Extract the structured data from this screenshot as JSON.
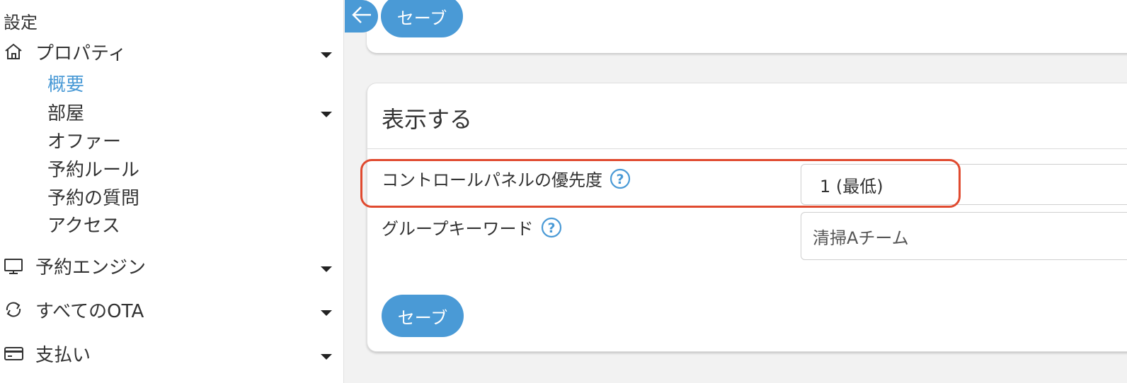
{
  "sidebar": {
    "title": "設定",
    "items": [
      {
        "label": "プロパティ",
        "icon": "home-icon"
      },
      {
        "label": "予約エンジン",
        "icon": "monitor-icon"
      },
      {
        "label": "すべてのOTA",
        "icon": "sync-icon"
      },
      {
        "label": "支払い",
        "icon": "credit-card-icon"
      }
    ],
    "subitems": [
      "概要",
      "部屋",
      "オファー",
      "予約ルール",
      "予約の質問",
      "アクセス"
    ]
  },
  "toolbar": {
    "save_label": "セーブ",
    "back_icon": "arrow-left-icon"
  },
  "card": {
    "title": "表示する",
    "fields": [
      {
        "label": "コントロールパネルの優先度",
        "value": "1 (最低)"
      },
      {
        "label": "グループキーワード",
        "value": "清掃Aチーム"
      }
    ],
    "save_label": "セーブ"
  },
  "colors": {
    "accent": "#4a9ad6",
    "highlight": "#e04a2f"
  }
}
